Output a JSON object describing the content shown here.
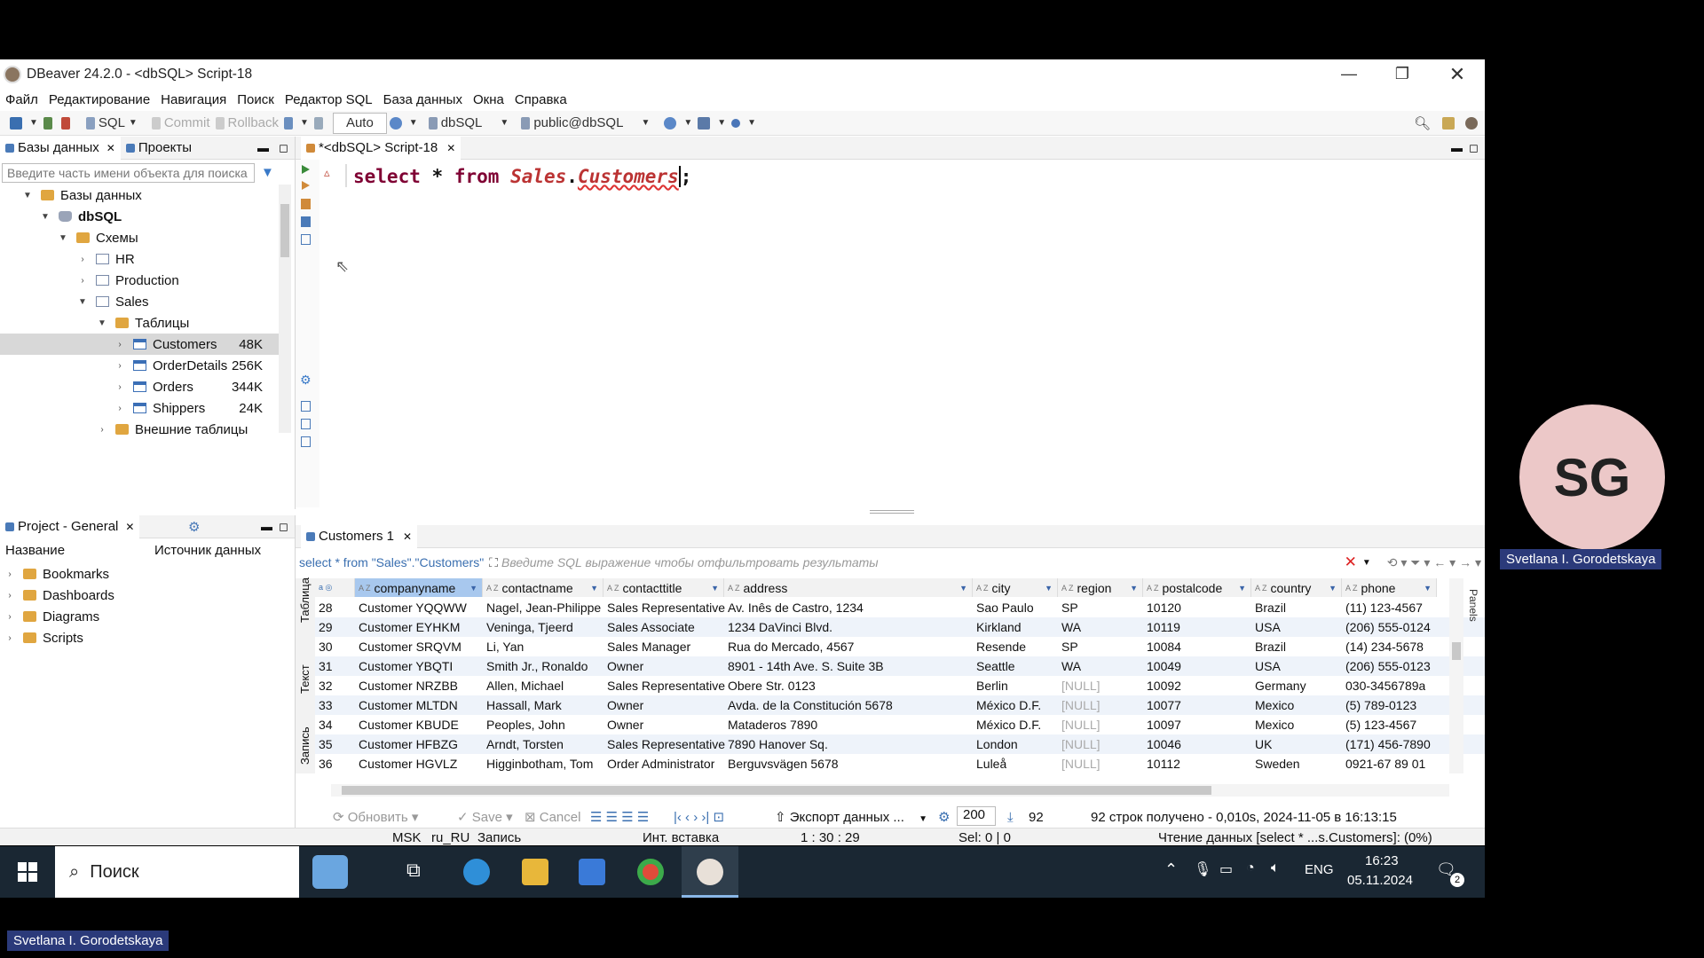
{
  "window": {
    "title": "DBeaver 24.2.0 - <dbSQL> Script-18"
  },
  "menu": [
    "Файл",
    "Редактирование",
    "Навигация",
    "Поиск",
    "Редактор SQL",
    "База данных",
    "Окна",
    "Справка"
  ],
  "toolbar": {
    "sql": "SQL",
    "commit": "Commit",
    "rollback": "Rollback",
    "mode": "Auto",
    "datasource": "dbSQL",
    "schema": "public@dbSQL"
  },
  "db_panel": {
    "tab1": "Базы данных",
    "tab2": "Проекты",
    "filter_placeholder": "Введите часть имени объекта для поиска",
    "tree": [
      {
        "label": "Базы данных",
        "size": ""
      },
      {
        "label": "dbSQL",
        "size": ""
      },
      {
        "label": "Схемы",
        "size": ""
      },
      {
        "label": "HR",
        "size": ""
      },
      {
        "label": "Production",
        "size": ""
      },
      {
        "label": "Sales",
        "size": ""
      },
      {
        "label": "Таблицы",
        "size": ""
      },
      {
        "label": "Customers",
        "size": "48K"
      },
      {
        "label": "OrderDetails",
        "size": "256K"
      },
      {
        "label": "Orders",
        "size": "344K"
      },
      {
        "label": "Shippers",
        "size": "24K"
      },
      {
        "label": "Внешние таблицы",
        "size": ""
      }
    ]
  },
  "project_panel": {
    "tab": "Project - General",
    "col1": "Название",
    "col2": "Источник данных",
    "items": [
      "Bookmarks",
      "Dashboards",
      "Diagrams",
      "Scripts"
    ]
  },
  "editor": {
    "tab": "*<dbSQL> Script-18",
    "code_kw1": "select",
    "code_star": "*",
    "code_kw2": "from",
    "code_schema": "Sales",
    "code_dot": ".",
    "code_table": "Customers",
    "code_semi": ";"
  },
  "results": {
    "tab": "Customers 1",
    "query": "select * from \"Sales\".\"Customers\"",
    "filter_placeholder": "Введите SQL выражение чтобы отфильтровать результаты",
    "side_tabs": [
      "Таблица",
      "Текст",
      "Запись"
    ],
    "columns": [
      "companyname",
      "contactname",
      "contacttitle",
      "address",
      "city",
      "region",
      "postalcode",
      "country",
      "phone"
    ],
    "rows": [
      [
        "28",
        "Customer YQQWW",
        "Nagel, Jean-Philippe",
        "Sales Representative",
        "Av. Inês de Castro, 1234",
        "Sao Paulo",
        "SP",
        "10120",
        "Brazil",
        "(11) 123-4567"
      ],
      [
        "29",
        "Customer EYHKM",
        "Veninga, Tjeerd",
        "Sales Associate",
        "1234 DaVinci Blvd.",
        "Kirkland",
        "WA",
        "10119",
        "USA",
        "(206) 555-0124"
      ],
      [
        "30",
        "Customer SRQVM",
        "Li, Yan",
        "Sales Manager",
        "Rua do Mercado, 4567",
        "Resende",
        "SP",
        "10084",
        "Brazil",
        "(14) 234-5678"
      ],
      [
        "31",
        "Customer YBQTI",
        "Smith Jr., Ronaldo",
        "Owner",
        "8901 - 14th Ave. S. Suite 3B",
        "Seattle",
        "WA",
        "10049",
        "USA",
        "(206) 555-0123"
      ],
      [
        "32",
        "Customer NRZBB",
        "Allen, Michael",
        "Sales Representative",
        "Obere Str. 0123",
        "Berlin",
        "[NULL]",
        "10092",
        "Germany",
        "030-3456789a"
      ],
      [
        "33",
        "Customer MLTDN",
        "Hassall, Mark",
        "Owner",
        "Avda. de la Constitución 5678",
        "México D.F.",
        "[NULL]",
        "10077",
        "Mexico",
        "(5) 789-0123"
      ],
      [
        "34",
        "Customer KBUDE",
        "Peoples, John",
        "Owner",
        "Mataderos  7890",
        "México D.F.",
        "[NULL]",
        "10097",
        "Mexico",
        "(5) 123-4567"
      ],
      [
        "35",
        "Customer HFBZG",
        "Arndt, Torsten",
        "Sales Representative",
        "7890 Hanover Sq.",
        "London",
        "[NULL]",
        "10046",
        "UK",
        "(171) 456-7890"
      ],
      [
        "36",
        "Customer HGVLZ",
        "Higginbotham, Tom",
        "Order Administrator",
        "Berguvsvägen  5678",
        "Luleå",
        "[NULL]",
        "10112",
        "Sweden",
        "0921-67 89 01"
      ]
    ],
    "refresh": "Обновить",
    "save": "Save",
    "cancel": "Cancel",
    "export": "Экспорт данных ...",
    "fetch_size": "200",
    "count": "92",
    "status": "92 строк получено - 0,010s, 2024-11-05 в 16:13:15"
  },
  "statusbar": {
    "tz": "MSK",
    "locale": "ru_RU",
    "mode": "Запись",
    "insert": "Инт. вставка",
    "pos": "1 : 30 : 29",
    "sel": "Sel: 0 | 0",
    "reading": "Чтение данных [select * ...s.Customers]: (0%)"
  },
  "taskbar": {
    "search": "Поиск",
    "lang": "ENG",
    "time": "16:23",
    "date": "05.11.2024",
    "notif": "2"
  },
  "participant": {
    "initials": "SG",
    "name": "Svetlana I. Gorodetskaya",
    "name_bottom": "Svetlana I. Gorodetskaya"
  }
}
